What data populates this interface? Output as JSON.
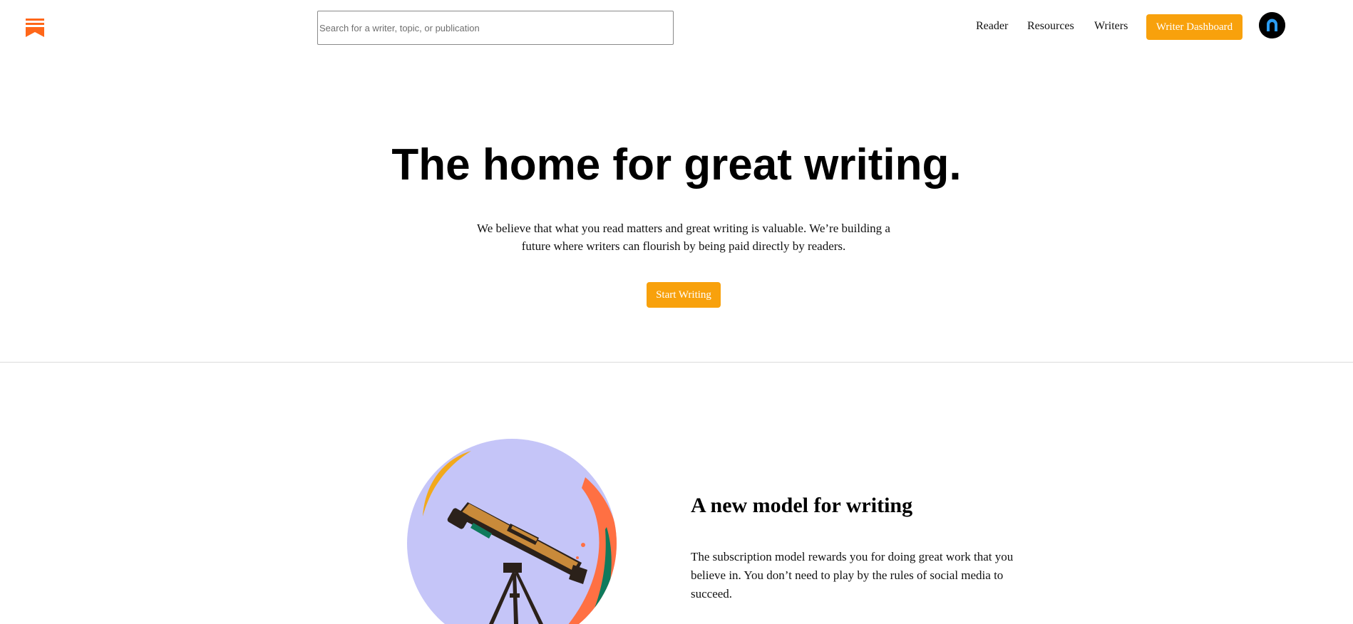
{
  "header": {
    "logo_icon": "substack-logo-icon",
    "search_placeholder": "Search for a writer, topic, or publication",
    "nav": {
      "reader": "Reader",
      "resources": "Resources",
      "writers": "Writers"
    },
    "dashboard_label": "Writer Dashboard",
    "avatar_icon": "user-avatar-icon"
  },
  "hero": {
    "title": "The home for great writing.",
    "subtitle": "We believe that what you read matters and great writing is valuable. We’re building a future where writers can flourish by being paid directly by readers.",
    "cta_label": "Start Writing"
  },
  "feature": {
    "illustration_icon": "telescope-illustration",
    "title": "A new model for writing",
    "text": "The subscription model rewards you for doing great work that you believe in. You don’t need to play by the rules of social media to succeed."
  },
  "colors": {
    "brand_orange": "#f8a10c",
    "logo_orange": "#ff6719",
    "illustration_lavender": "#c5c5f8",
    "illustration_green": "#0f7a5c"
  }
}
